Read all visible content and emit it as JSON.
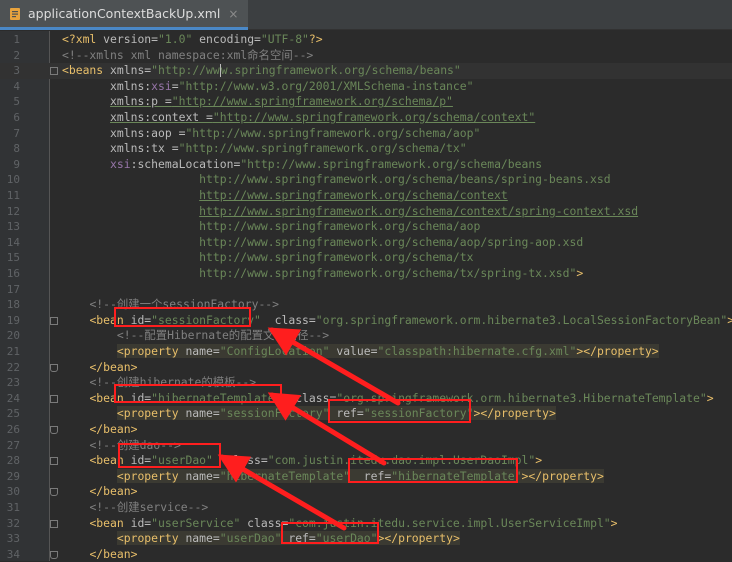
{
  "tab": {
    "filename": "applicationContextBackUp.xml",
    "icon": "xml-file-icon",
    "close": "×"
  },
  "colors": {
    "background": "#2b2b2b",
    "tag": "#e8bf6a",
    "attribute": "#bababa",
    "string": "#6a8759",
    "comment": "#808080",
    "namespace": "#9876aa",
    "annotation": "#ff1e1e"
  },
  "editor": {
    "current_line": 3,
    "lines": [
      {
        "num": "1",
        "fold": "",
        "hl": false,
        "tokens": [
          [
            "pi",
            "<?"
          ],
          [
            "pi",
            "xml"
          ],
          [
            "attr",
            " version="
          ],
          [
            "str",
            "\"1.0\""
          ],
          [
            "attr",
            " encoding="
          ],
          [
            "str",
            "\"UTF-8\""
          ],
          [
            "pi",
            "?>"
          ]
        ]
      },
      {
        "num": "2",
        "fold": "",
        "hl": false,
        "tokens": [
          [
            "comment",
            "<!--xmlns xml namespace:xml命名空间-->"
          ]
        ]
      },
      {
        "num": "3",
        "fold": "open",
        "hl": false,
        "tokens": [
          [
            "tag",
            "<beans "
          ],
          [
            "attr",
            "xmlns="
          ],
          [
            "str",
            "\"http://ww"
          ],
          [
            "caret",
            ""
          ],
          [
            "str",
            "w.springframework.org/schema/beans\""
          ]
        ]
      },
      {
        "num": "4",
        "fold": "",
        "hl": false,
        "tokens": [
          [
            "plain",
            "       "
          ],
          [
            "attr",
            "xmlns:"
          ],
          [
            "ns",
            "xsi"
          ],
          [
            "attr",
            "="
          ],
          [
            "str",
            "\"http://www.w3.org/2001/XMLSchema-instance\""
          ]
        ]
      },
      {
        "num": "5",
        "fold": "",
        "hl": false,
        "tokens": [
          [
            "plain",
            "       "
          ],
          [
            "attr_u",
            "xmlns:p ="
          ],
          [
            "str_u",
            "\"http://www.springframework.org/schema/p\""
          ]
        ]
      },
      {
        "num": "6",
        "fold": "",
        "hl": false,
        "tokens": [
          [
            "plain",
            "       "
          ],
          [
            "attr_u",
            "xmlns:context ="
          ],
          [
            "str_u",
            "\"http://www.springframework.org/schema/context\""
          ]
        ]
      },
      {
        "num": "7",
        "fold": "",
        "hl": false,
        "tokens": [
          [
            "plain",
            "       "
          ],
          [
            "attr",
            "xmlns:aop ="
          ],
          [
            "str",
            "\"http://www.springframework.org/schema/aop\""
          ]
        ]
      },
      {
        "num": "8",
        "fold": "",
        "hl": false,
        "tokens": [
          [
            "plain",
            "       "
          ],
          [
            "attr",
            "xmlns:tx ="
          ],
          [
            "str",
            "\"http://www.springframework.org/schema/tx\""
          ]
        ]
      },
      {
        "num": "9",
        "fold": "",
        "hl": false,
        "tokens": [
          [
            "plain",
            "       "
          ],
          [
            "ns",
            "xsi"
          ],
          [
            "attr",
            ":schemaLocation="
          ],
          [
            "str",
            "\"http://www.springframework.org/schema/beans"
          ]
        ]
      },
      {
        "num": "10",
        "fold": "",
        "hl": false,
        "tokens": [
          [
            "plain",
            "                    "
          ],
          [
            "str",
            "http://www.springframework.org/schema/beans/spring-beans.xsd"
          ]
        ]
      },
      {
        "num": "11",
        "fold": "",
        "hl": false,
        "tokens": [
          [
            "plain",
            "                    "
          ],
          [
            "str_u",
            "http://www.springframework.org/schema/context"
          ]
        ]
      },
      {
        "num": "12",
        "fold": "",
        "hl": false,
        "tokens": [
          [
            "plain",
            "                    "
          ],
          [
            "str_u",
            "http://www.springframework.org/schema/context/spring-context.xsd"
          ]
        ]
      },
      {
        "num": "13",
        "fold": "",
        "hl": false,
        "tokens": [
          [
            "plain",
            "                    "
          ],
          [
            "str",
            "http://www.springframework.org/schema/aop"
          ]
        ]
      },
      {
        "num": "14",
        "fold": "",
        "hl": false,
        "tokens": [
          [
            "plain",
            "                    "
          ],
          [
            "str",
            "http://www.springframework.org/schema/aop/spring-aop.xsd"
          ]
        ]
      },
      {
        "num": "15",
        "fold": "",
        "hl": false,
        "tokens": [
          [
            "plain",
            "                    "
          ],
          [
            "str",
            "http://www.springframework.org/schema/tx"
          ]
        ]
      },
      {
        "num": "16",
        "fold": "",
        "hl": false,
        "tokens": [
          [
            "plain",
            "                    "
          ],
          [
            "str",
            "http://www.springframework.org/schema/tx/spring-tx.xsd\""
          ],
          [
            "tag",
            ">"
          ]
        ]
      },
      {
        "num": "17",
        "fold": "",
        "hl": false,
        "tokens": []
      },
      {
        "num": "18",
        "fold": "",
        "hl": false,
        "tokens": [
          [
            "plain",
            "    "
          ],
          [
            "comment",
            "<!--创建一个sessionFactory-->"
          ]
        ]
      },
      {
        "num": "19",
        "fold": "open",
        "hl": false,
        "tokens": [
          [
            "plain",
            "    "
          ],
          [
            "tag",
            "<bean "
          ],
          [
            "attr",
            "id="
          ],
          [
            "str",
            "\"sessionFactory\""
          ],
          [
            "attr",
            "  class="
          ],
          [
            "str",
            "\"org.springframework.orm.hibernate3.LocalSessionFactoryBean\""
          ],
          [
            "tag",
            ">"
          ]
        ]
      },
      {
        "num": "20",
        "fold": "",
        "hl": false,
        "tokens": [
          [
            "plain",
            "        "
          ],
          [
            "comment",
            "<!--配置Hibernate的配置文件路径-->"
          ]
        ]
      },
      {
        "num": "21",
        "fold": "",
        "hl": true,
        "tokens": [
          [
            "plain",
            "        "
          ],
          [
            "tag",
            "<property "
          ],
          [
            "attr",
            "name="
          ],
          [
            "str",
            "\"ConfigLocation\""
          ],
          [
            "attr",
            " value="
          ],
          [
            "str",
            "\"classpath:hibernate.cfg.xml\""
          ],
          [
            "tag",
            "></property>"
          ]
        ]
      },
      {
        "num": "22",
        "fold": "close",
        "hl": false,
        "tokens": [
          [
            "plain",
            "    "
          ],
          [
            "tag",
            "</bean>"
          ]
        ]
      },
      {
        "num": "23",
        "fold": "",
        "hl": false,
        "tokens": [
          [
            "plain",
            "    "
          ],
          [
            "comment",
            "<!--创建hibernate的模板-->"
          ]
        ]
      },
      {
        "num": "24",
        "fold": "open",
        "hl": false,
        "tokens": [
          [
            "plain",
            "    "
          ],
          [
            "tag",
            "<bean "
          ],
          [
            "attr",
            "id="
          ],
          [
            "str",
            "\"hibernateTemplate\""
          ],
          [
            "attr",
            "  class="
          ],
          [
            "str",
            "\"org.springframework.orm.hibernate3.HibernateTemplate\""
          ],
          [
            "tag",
            ">"
          ]
        ]
      },
      {
        "num": "25",
        "fold": "",
        "hl": true,
        "tokens": [
          [
            "plain",
            "        "
          ],
          [
            "tag",
            "<property "
          ],
          [
            "attr",
            "name="
          ],
          [
            "str",
            "\"sessionFactory\""
          ],
          [
            "attr",
            " ref="
          ],
          [
            "str",
            "\"sessionFactory\""
          ],
          [
            "tag",
            "></property>"
          ]
        ]
      },
      {
        "num": "26",
        "fold": "close",
        "hl": false,
        "tokens": [
          [
            "plain",
            "    "
          ],
          [
            "tag",
            "</bean>"
          ]
        ]
      },
      {
        "num": "27",
        "fold": "",
        "hl": false,
        "tokens": [
          [
            "plain",
            "    "
          ],
          [
            "comment",
            "<!--创建dao-->"
          ]
        ]
      },
      {
        "num": "28",
        "fold": "open",
        "hl": false,
        "tokens": [
          [
            "plain",
            "    "
          ],
          [
            "tag",
            "<bean "
          ],
          [
            "attr",
            "id="
          ],
          [
            "str",
            "\"userDao\""
          ],
          [
            "attr",
            "  class="
          ],
          [
            "str",
            "\"com.justin.itedu.dao.impl.UserDaoImpl\""
          ],
          [
            "tag",
            ">"
          ]
        ]
      },
      {
        "num": "29",
        "fold": "",
        "hl": true,
        "tokens": [
          [
            "plain",
            "        "
          ],
          [
            "tag",
            "<property "
          ],
          [
            "attr",
            "name="
          ],
          [
            "str",
            "\"hibernateTemplate\""
          ],
          [
            "attr",
            "  ref="
          ],
          [
            "str",
            "\"hibernateTemplate\""
          ],
          [
            "tag",
            "></property>"
          ]
        ]
      },
      {
        "num": "30",
        "fold": "close",
        "hl": false,
        "tokens": [
          [
            "plain",
            "    "
          ],
          [
            "tag",
            "</bean>"
          ]
        ]
      },
      {
        "num": "31",
        "fold": "",
        "hl": false,
        "tokens": [
          [
            "plain",
            "    "
          ],
          [
            "comment",
            "<!--创建service-->"
          ]
        ]
      },
      {
        "num": "32",
        "fold": "open",
        "hl": false,
        "tokens": [
          [
            "plain",
            "    "
          ],
          [
            "tag",
            "<bean "
          ],
          [
            "attr",
            "id="
          ],
          [
            "str",
            "\"userService\""
          ],
          [
            "attr",
            " class="
          ],
          [
            "str",
            "\"com.justin.itedu.service.impl.UserServiceImpl\""
          ],
          [
            "tag",
            ">"
          ]
        ]
      },
      {
        "num": "33",
        "fold": "",
        "hl": true,
        "tokens": [
          [
            "plain",
            "        "
          ],
          [
            "tag",
            "<property "
          ],
          [
            "attr",
            "name="
          ],
          [
            "str",
            "\"userDao\""
          ],
          [
            "attr",
            " ref="
          ],
          [
            "str",
            "\"userDao\""
          ],
          [
            "tag",
            "></property>"
          ]
        ]
      },
      {
        "num": "34",
        "fold": "close",
        "hl": false,
        "tokens": [
          [
            "plain",
            "    "
          ],
          [
            "tag",
            "</bean>"
          ]
        ]
      }
    ]
  }
}
